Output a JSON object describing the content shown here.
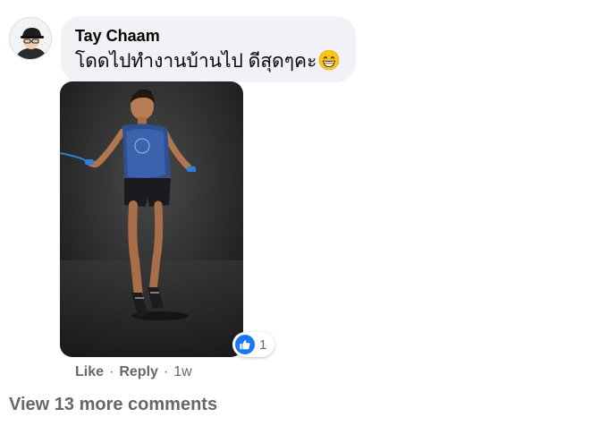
{
  "comment": {
    "author": "Tay Chaam",
    "text": "โดดไปทำงานบ้านไป ดีสุดๆคะ",
    "emoji": "grinning-face-with-smiling-eyes",
    "reaction_count": "1",
    "reaction_type": "like-icon",
    "actions": {
      "like": "Like",
      "separator": "·",
      "reply": "Reply",
      "time": "1w"
    }
  },
  "view_more": "View 13 more comments",
  "colors": {
    "bubble": "#f0f2f5",
    "like_blue": "#1877f2",
    "secondary_text": "#65676b"
  }
}
